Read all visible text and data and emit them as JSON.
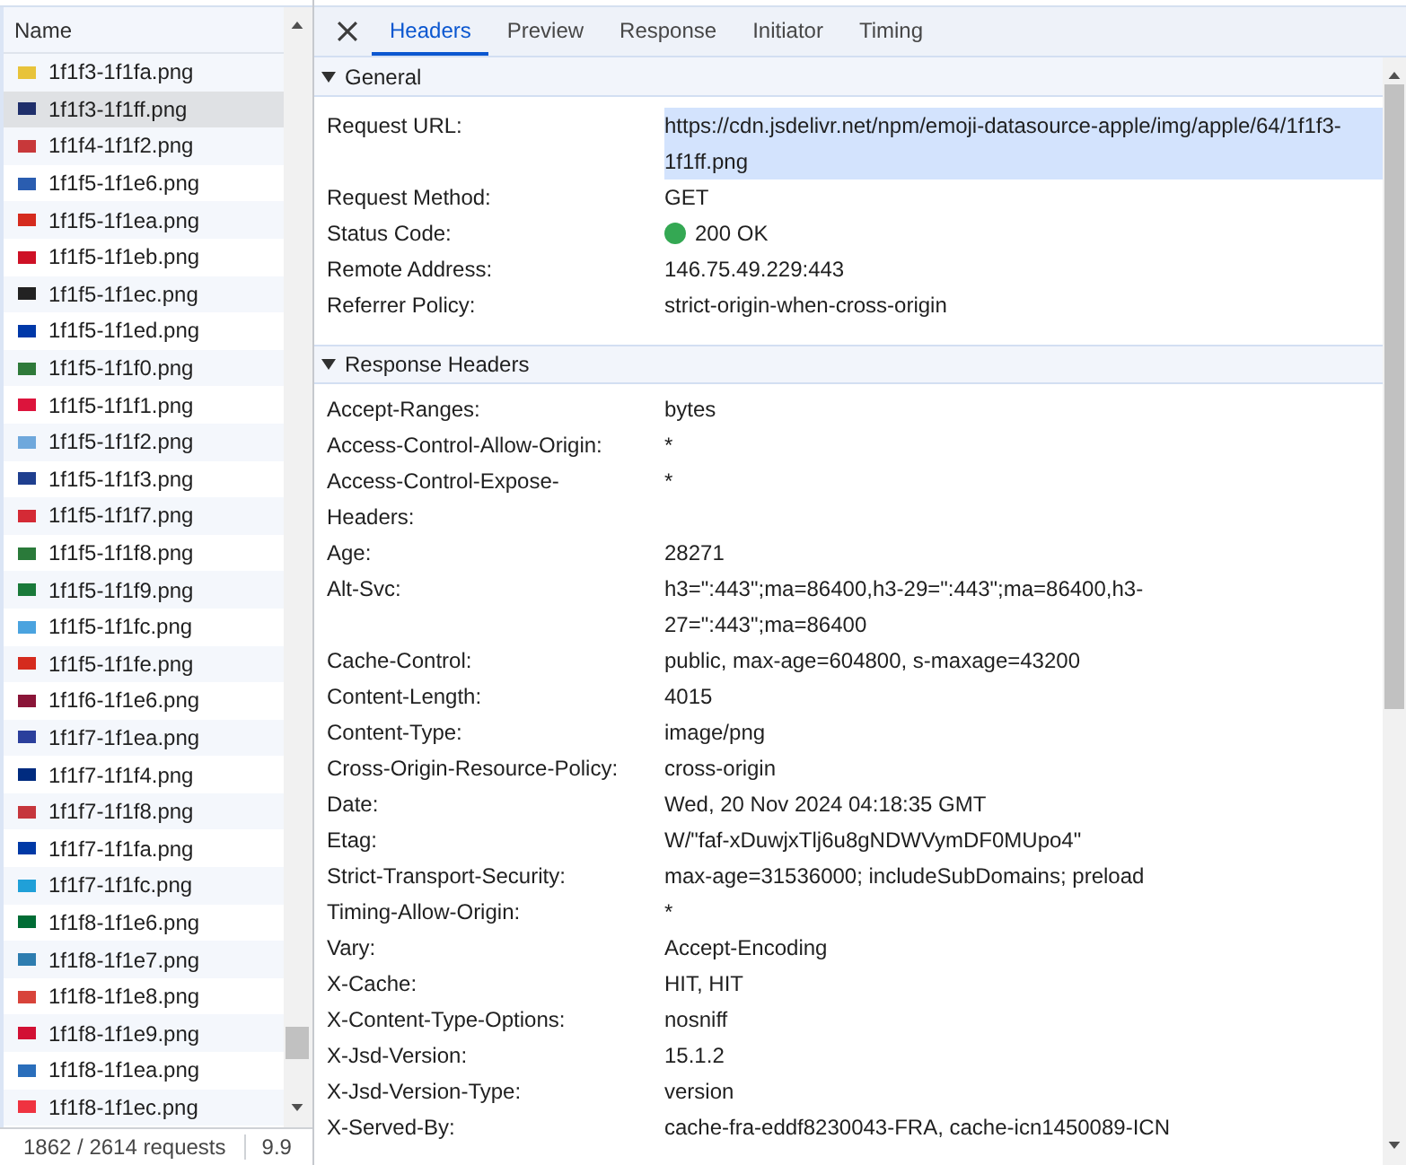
{
  "request_list": {
    "column": "Name",
    "rows": [
      {
        "name": "1f1f3-1f1fa.png",
        "color": "#e8c33a",
        "selected": false
      },
      {
        "name": "1f1f3-1f1ff.png",
        "color": "#1f2f6b",
        "selected": true
      },
      {
        "name": "1f1f4-1f1f2.png",
        "color": "#c8383a",
        "selected": false
      },
      {
        "name": "1f1f5-1f1e6.png",
        "color": "#2a5db0",
        "selected": false
      },
      {
        "name": "1f1f5-1f1ea.png",
        "color": "#d52b1e",
        "selected": false
      },
      {
        "name": "1f1f5-1f1eb.png",
        "color": "#ce1126",
        "selected": false
      },
      {
        "name": "1f1f5-1f1ec.png",
        "color": "#222222",
        "selected": false
      },
      {
        "name": "1f1f5-1f1ed.png",
        "color": "#0038a8",
        "selected": false
      },
      {
        "name": "1f1f5-1f1f0.png",
        "color": "#2f7a3a",
        "selected": false
      },
      {
        "name": "1f1f5-1f1f1.png",
        "color": "#dc143c",
        "selected": false
      },
      {
        "name": "1f1f5-1f1f2.png",
        "color": "#6fa8dc",
        "selected": false
      },
      {
        "name": "1f1f5-1f1f3.png",
        "color": "#1f3f8f",
        "selected": false
      },
      {
        "name": "1f1f5-1f1f7.png",
        "color": "#d42a35",
        "selected": false
      },
      {
        "name": "1f1f5-1f1f8.png",
        "color": "#2a7a3a",
        "selected": false
      },
      {
        "name": "1f1f5-1f1f9.png",
        "color": "#1a7a3a",
        "selected": false
      },
      {
        "name": "1f1f5-1f1fc.png",
        "color": "#4aa3df",
        "selected": false
      },
      {
        "name": "1f1f5-1f1fe.png",
        "color": "#d52b1e",
        "selected": false
      },
      {
        "name": "1f1f6-1f1e6.png",
        "color": "#8a1538",
        "selected": false
      },
      {
        "name": "1f1f7-1f1ea.png",
        "color": "#2b3f9c",
        "selected": false
      },
      {
        "name": "1f1f7-1f1f4.png",
        "color": "#002b7f",
        "selected": false
      },
      {
        "name": "1f1f7-1f1f8.png",
        "color": "#c6363c",
        "selected": false
      },
      {
        "name": "1f1f7-1f1fa.png",
        "color": "#0039a6",
        "selected": false
      },
      {
        "name": "1f1f7-1f1fc.png",
        "color": "#20a0d8",
        "selected": false
      },
      {
        "name": "1f1f8-1f1e6.png",
        "color": "#006c35",
        "selected": false
      },
      {
        "name": "1f1f8-1f1e7.png",
        "color": "#2e7db0",
        "selected": false
      },
      {
        "name": "1f1f8-1f1e8.png",
        "color": "#d8433a",
        "selected": false
      },
      {
        "name": "1f1f8-1f1e9.png",
        "color": "#d21034",
        "selected": false
      },
      {
        "name": "1f1f8-1f1ea.png",
        "color": "#2a6ebb",
        "selected": false
      },
      {
        "name": "1f1f8-1f1ec.png",
        "color": "#ef3340",
        "selected": false
      }
    ]
  },
  "status_bar": {
    "requests": "1862 / 2614 requests",
    "transferred": "9.9"
  },
  "details": {
    "tabs": [
      {
        "label": "Headers",
        "selected": true
      },
      {
        "label": "Preview",
        "selected": false
      },
      {
        "label": "Response",
        "selected": false
      },
      {
        "label": "Initiator",
        "selected": false
      },
      {
        "label": "Timing",
        "selected": false
      }
    ],
    "sections": [
      {
        "title": "General",
        "expanded": true,
        "rows": [
          {
            "name": "Request URL:",
            "value": "https://cdn.jsdelivr.net/npm/emoji-datasource-apple/img/apple/64/1f1f3-1f1ff.png",
            "kind": "text",
            "highlighted": true
          },
          {
            "name": "Request Method:",
            "value": "GET",
            "kind": "text",
            "highlighted": false
          },
          {
            "name": "Status Code:",
            "value": "200 OK",
            "kind": "status",
            "highlighted": false
          },
          {
            "name": "Remote Address:",
            "value": "146.75.49.229:443",
            "kind": "text",
            "highlighted": false
          },
          {
            "name": "Referrer Policy:",
            "value": "strict-origin-when-cross-origin",
            "kind": "text",
            "highlighted": false
          }
        ]
      },
      {
        "title": "Response Headers",
        "expanded": true,
        "rows": [
          {
            "name": "Accept-Ranges:",
            "value": "bytes"
          },
          {
            "name": "Access-Control-Allow-Origin:",
            "value": "*"
          },
          {
            "name": "Access-Control-Expose-Headers:",
            "value": "*"
          },
          {
            "name": "Age:",
            "value": "28271"
          },
          {
            "name": "Alt-Svc:",
            "value": "h3=\":443\";ma=86400,h3-29=\":443\";ma=86400,h3-27=\":443\";ma=86400"
          },
          {
            "name": "Cache-Control:",
            "value": "public, max-age=604800, s-maxage=43200"
          },
          {
            "name": "Content-Length:",
            "value": "4015"
          },
          {
            "name": "Content-Type:",
            "value": "image/png"
          },
          {
            "name": "Cross-Origin-Resource-Policy:",
            "value": "cross-origin"
          },
          {
            "name": "Date:",
            "value": "Wed, 20 Nov 2024 04:18:35 GMT"
          },
          {
            "name": "Etag:",
            "value": "W/\"faf-xDuwjxTlj6u8gNDWVymDF0MUpo4\""
          },
          {
            "name": "Strict-Transport-Security:",
            "value": "max-age=31536000; includeSubDomains; preload"
          },
          {
            "name": "Timing-Allow-Origin:",
            "value": "*"
          },
          {
            "name": "Vary:",
            "value": "Accept-Encoding"
          },
          {
            "name": "X-Cache:",
            "value": "HIT, HIT"
          },
          {
            "name": "X-Content-Type-Options:",
            "value": "nosniff"
          },
          {
            "name": "X-Jsd-Version:",
            "value": "15.1.2"
          },
          {
            "name": "X-Jsd-Version-Type:",
            "value": "version"
          },
          {
            "name": "X-Served-By:",
            "value": "cache-fra-eddf8230043-FRA, cache-icn1450089-ICN"
          }
        ]
      }
    ]
  }
}
